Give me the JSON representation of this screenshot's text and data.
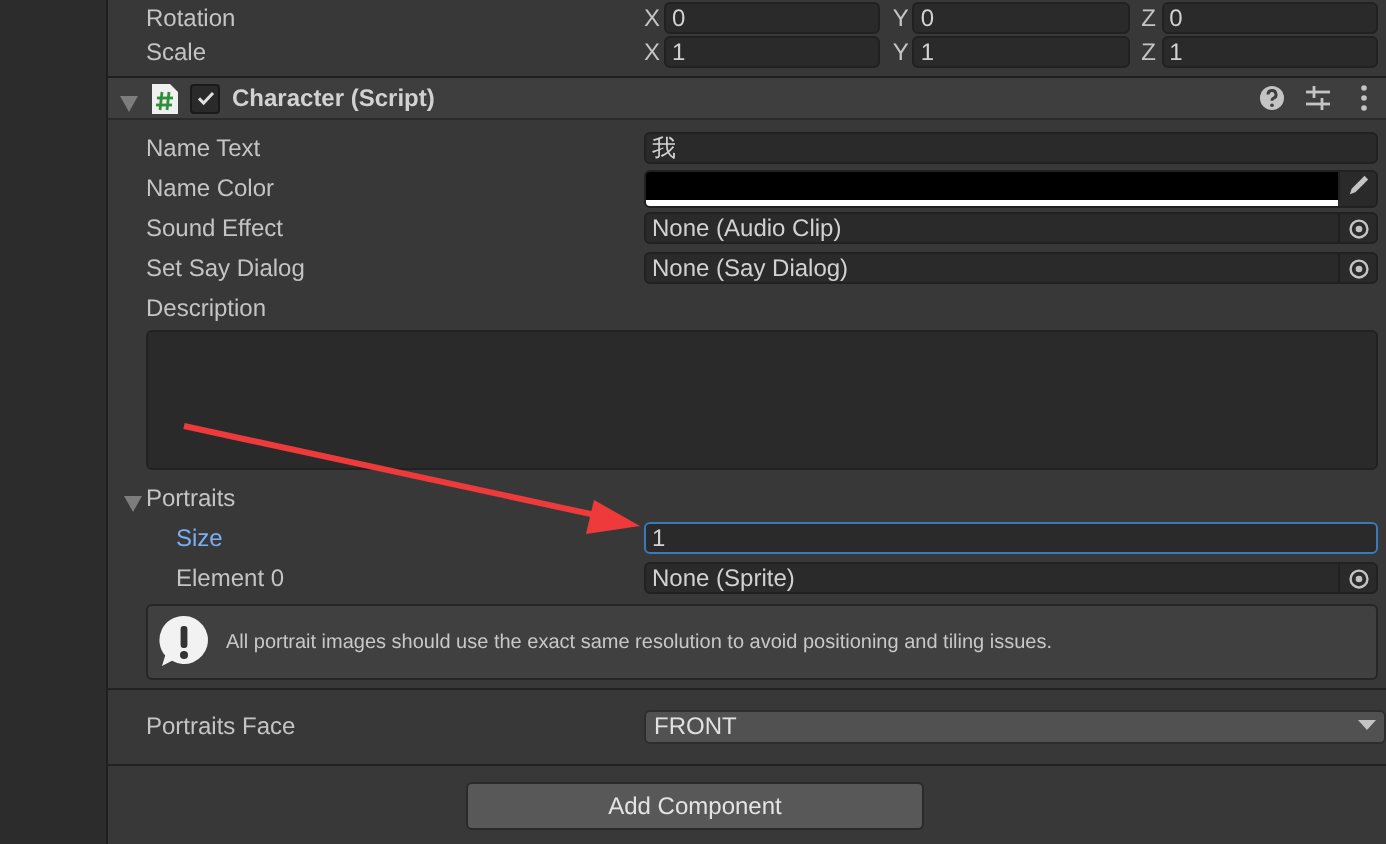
{
  "transform_rows": [
    {
      "label": "Rotation",
      "axes": [
        {
          "axis": "X",
          "value": "0"
        },
        {
          "axis": "Y",
          "value": "0"
        },
        {
          "axis": "Z",
          "value": "0"
        }
      ]
    },
    {
      "label": "Scale",
      "axes": [
        {
          "axis": "X",
          "value": "1"
        },
        {
          "axis": "Y",
          "value": "1"
        },
        {
          "axis": "Z",
          "value": "1"
        }
      ]
    }
  ],
  "component": {
    "title": "Character (Script)",
    "enabled": true,
    "expanded": true,
    "fields": [
      {
        "kind": "text",
        "label": "Name Text",
        "value": "我"
      },
      {
        "kind": "color",
        "label": "Name Color",
        "color": "#000000"
      },
      {
        "kind": "object",
        "label": "Sound Effect",
        "value": "None (Audio Clip)"
      },
      {
        "kind": "object",
        "label": "Set Say Dialog",
        "value": "None (Say Dialog)"
      },
      {
        "kind": "textarea",
        "label": "Description"
      },
      {
        "kind": "foldout",
        "label": "Portraits",
        "expanded": true,
        "children": [
          {
            "kind": "text",
            "label": "Size",
            "value": "1",
            "focused": true
          },
          {
            "kind": "object",
            "label": "Element 0",
            "value": "None (Sprite)"
          }
        ]
      },
      {
        "kind": "helpbox",
        "text": "All portrait images should use the exact same resolution to avoid positioning and tiling issues."
      },
      {
        "kind": "enum",
        "label": "Portraits Face",
        "value": "FRONT"
      }
    ]
  },
  "add_component_button": "Add Component"
}
